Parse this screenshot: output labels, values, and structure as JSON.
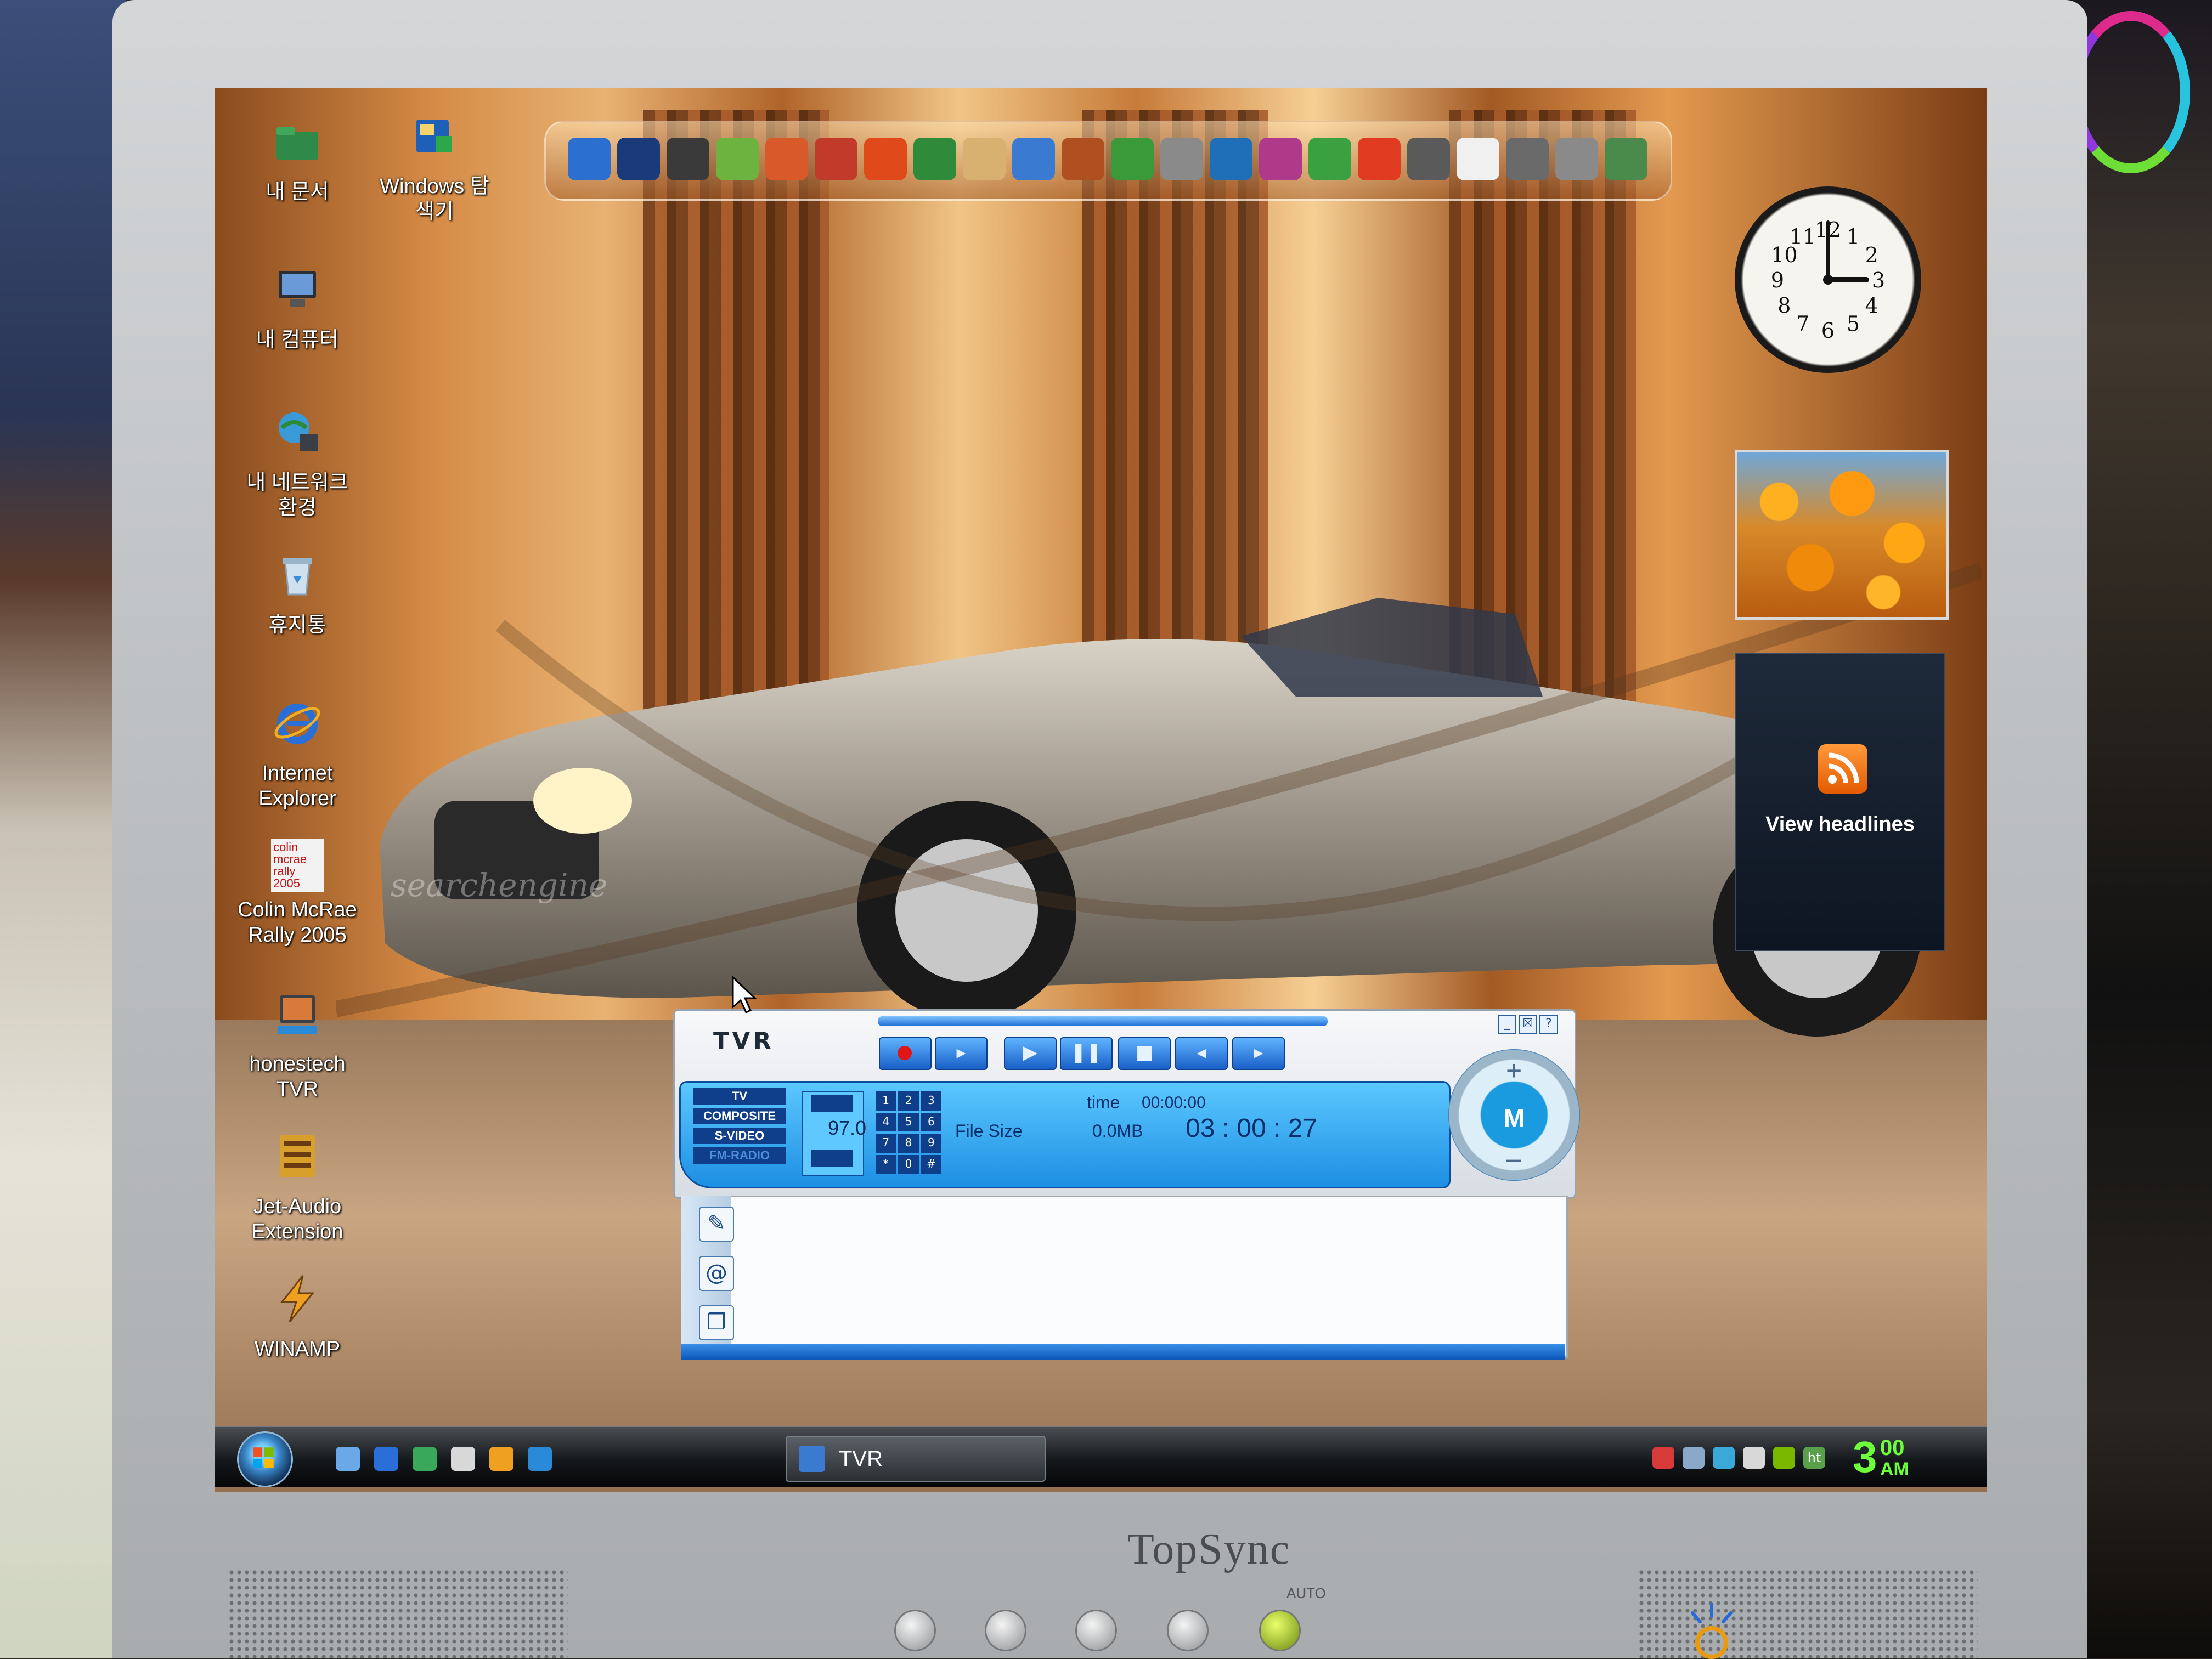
{
  "monitor": {
    "brand": "TopSync",
    "auto_label": "AUTO"
  },
  "desktop": {
    "icons": [
      {
        "label": "내 문서",
        "icon": "folder-icon"
      },
      {
        "label": "Windows 탐색기",
        "icon": "explorer-icon"
      },
      {
        "label": "내 컴퓨터",
        "icon": "computer-icon"
      },
      {
        "label": "내 네트워크 환경",
        "icon": "network-icon"
      },
      {
        "label": "휴지통",
        "icon": "recycle-bin-icon"
      },
      {
        "label": "Internet Explorer",
        "icon": "ie-icon"
      },
      {
        "label": "Colin McRae Rally 2005",
        "icon": "game-icon"
      },
      {
        "label": "honestech TVR",
        "icon": "tvr-icon"
      },
      {
        "label": "Jet-Audio Extension",
        "icon": "jetaudio-icon"
      },
      {
        "label": "WINAMP",
        "icon": "winamp-icon"
      }
    ],
    "game_icon_text": "colin mcrae rally 2005",
    "wallpaper_watermark": "searchengine"
  },
  "dock": {
    "items": [
      "media-player-icon",
      "photoshop-icon",
      "flash-icon",
      "cd-icon",
      "paint-icon",
      "book-icon",
      "app-icon",
      "monitor-icon",
      "folder-icon",
      "calc-icon",
      "tool-icon",
      "leaf-icon",
      "user-icon",
      "excel-icon",
      "disc-icon",
      "utorrent-icon",
      "wand-icon",
      "gear-icon",
      "lifebuoy-icon",
      "eye-icon",
      "speaker-icon",
      "trash-icon"
    ],
    "item_colors": [
      "#2b6fd0",
      "#1b3a7a",
      "#3a3a3a",
      "#6db33f",
      "#d85a2a",
      "#c23a2a",
      "#e04a1a",
      "#2f8a3a",
      "#d8b070",
      "#3a7ad0",
      "#b05020",
      "#3a9a3a",
      "#8a8a8a",
      "#1f6fb8",
      "#b03a8a",
      "#3aa040",
      "#e03a20",
      "#5a5a5a",
      "#f0f0f0",
      "#6a6a6a",
      "#8a8a8a",
      "#4a8a4a"
    ]
  },
  "sidebar": {
    "clock": {
      "numbers": [
        "12",
        "1",
        "2",
        "3",
        "4",
        "5",
        "6",
        "7",
        "8",
        "9",
        "10",
        "11"
      ],
      "hour": 3,
      "minute": 0
    },
    "feed": {
      "text": "View headlines"
    }
  },
  "tvr": {
    "title": "TVR",
    "window_buttons": [
      "_",
      "☒",
      "?"
    ],
    "controls": [
      {
        "name": "record-button",
        "glyph": ""
      },
      {
        "name": "prev-button",
        "glyph": "▸"
      },
      {
        "name": "play-button",
        "glyph": "▶"
      },
      {
        "name": "pause-button",
        "glyph": "❚❚"
      },
      {
        "name": "stop-button",
        "glyph": "■"
      },
      {
        "name": "rewind-button",
        "glyph": "◂"
      },
      {
        "name": "forward-button",
        "glyph": "▸"
      }
    ],
    "sources": [
      "TV",
      "COMPOSITE",
      "S-VIDEO",
      "FM-RADIO"
    ],
    "channel": "97.0",
    "keypad": [
      "1",
      "2",
      "3",
      "4",
      "5",
      "6",
      "7",
      "8",
      "9",
      "*",
      "0",
      "#"
    ],
    "time_label": "time",
    "time_value": "00:00:00",
    "filesize_label": "File Size",
    "filesize_value": "0.0MB",
    "elapsed": "03 : 00 : 27",
    "knob_label": "M",
    "knob_plus": "+",
    "knob_minus": "–"
  },
  "taskbar": {
    "window_label": "TVR",
    "clock_hour": "3",
    "clock_minute": "00",
    "clock_ampm": "AM",
    "tray_text": "ht"
  }
}
